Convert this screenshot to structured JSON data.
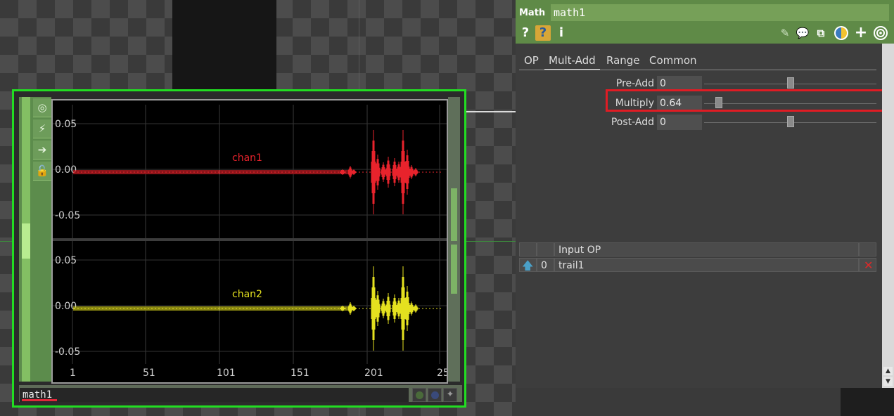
{
  "network": {
    "node": {
      "name": "math1",
      "tools": [
        "target-icon",
        "activity-icon",
        "arrow-right-icon",
        "lock-icon"
      ]
    },
    "viewer": {
      "x_ticks": [
        "1",
        "51",
        "101",
        "151",
        "201",
        "25"
      ],
      "channels": [
        {
          "name": "chan1",
          "color": "#e8232c",
          "y_ticks": [
            "0.05",
            "0.00",
            "-0.05"
          ]
        },
        {
          "name": "chan2",
          "color": "#e4e11f",
          "y_ticks": [
            "0.05",
            "0.00",
            "-0.05"
          ]
        }
      ]
    }
  },
  "panel": {
    "op_type": "Math",
    "op_name": "math1",
    "header_icons": {
      "help": "?",
      "python_help": "?",
      "info": "i",
      "right": [
        "pencil-icon",
        "comment-icon",
        "clone-icon",
        "python-icon",
        "plus-icon",
        "viewer-icon"
      ]
    },
    "tabs": [
      "OP",
      "Mult-Add",
      "Range",
      "Common"
    ],
    "active_tab": "Mult-Add",
    "params": [
      {
        "label": "Pre-Add",
        "value": "0",
        "slider_fraction": 0.5
      },
      {
        "label": "Multiply",
        "value": "0.64",
        "slider_fraction": 0.2
      },
      {
        "label": "Post-Add",
        "value": "0",
        "slider_fraction": 0.5
      }
    ],
    "input_table": {
      "header": "Input OP",
      "rows": [
        {
          "index": "0",
          "op": "trail1"
        }
      ]
    }
  }
}
